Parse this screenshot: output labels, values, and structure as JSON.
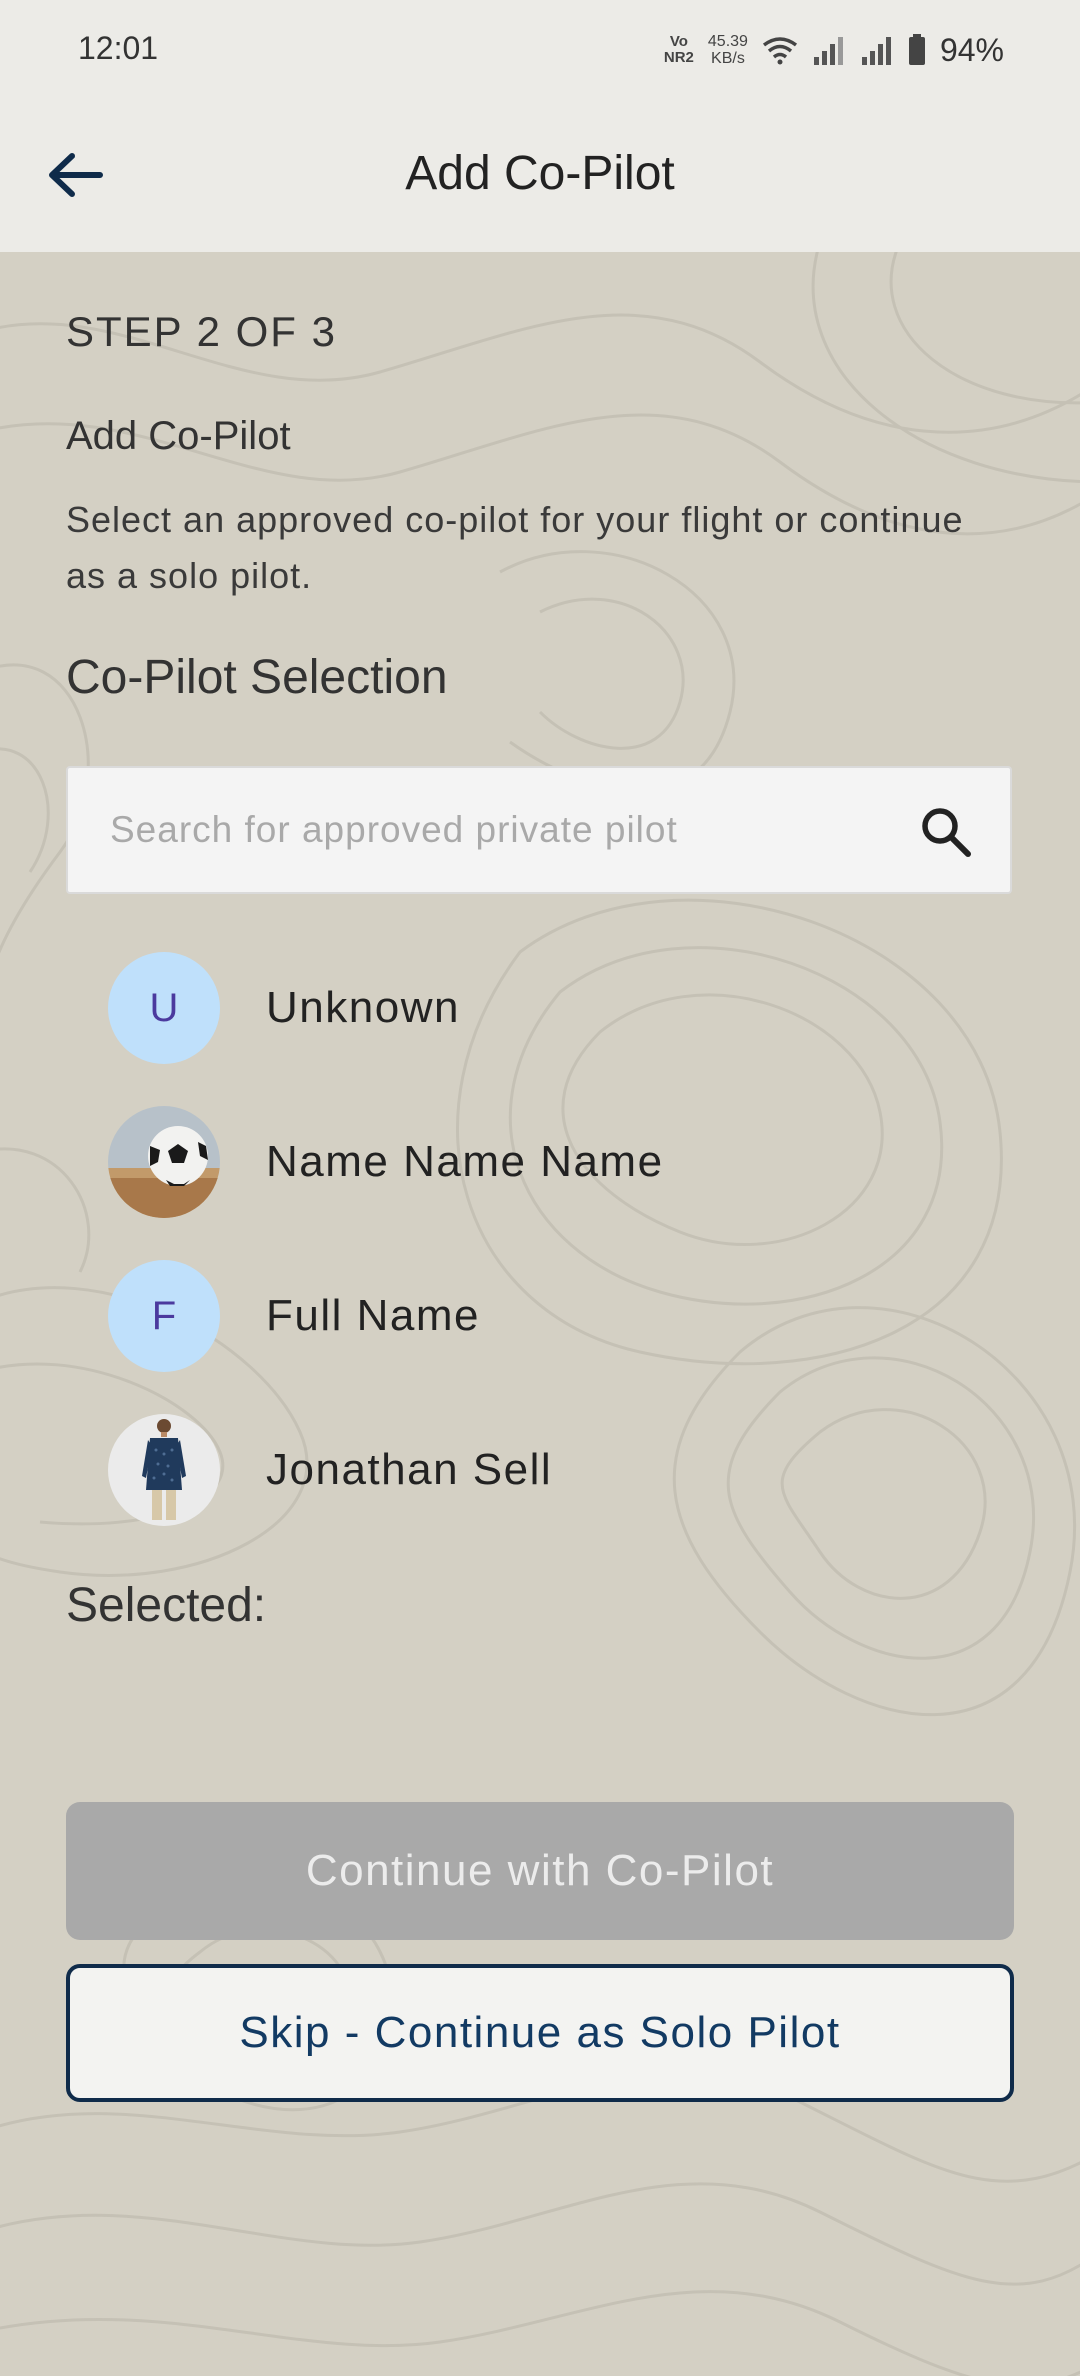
{
  "status_bar": {
    "time": "12:01",
    "net_type_top": "Vo",
    "net_type_bottom": "NR2",
    "net_speed_value": "45.39",
    "net_speed_unit": "KB/s",
    "battery": "94%"
  },
  "app_bar": {
    "title": "Add Co-Pilot",
    "back_icon": "arrow-left-icon"
  },
  "step": {
    "label": "STEP 2 OF 3",
    "heading": "Add Co-Pilot",
    "description": "Select an approved co-pilot for your flight or continue as a solo pilot."
  },
  "selection": {
    "heading": "Co-Pilot Selection",
    "search_placeholder": "Search for approved private pilot",
    "search_value": "",
    "search_icon": "search-icon"
  },
  "pilots": [
    {
      "name": "Unknown",
      "avatar_type": "letter",
      "initial": "U"
    },
    {
      "name": "Name Name Name",
      "avatar_type": "photo",
      "photo": "soccer-ball-photo"
    },
    {
      "name": "Full Name",
      "avatar_type": "letter",
      "initial": "F"
    },
    {
      "name": "Jonathan Sell",
      "avatar_type": "photo",
      "photo": "man-in-kurta-photo"
    }
  ],
  "selected": {
    "label": "Selected:"
  },
  "actions": {
    "continue_label": "Continue with Co-Pilot",
    "skip_label": "Skip - Continue as Solo Pilot"
  },
  "colors": {
    "background": "#d4d0c4",
    "header": "#ecebe7",
    "avatar_bg": "#bfe0fb",
    "avatar_letter": "#4b3a9e",
    "primary_navy": "#0f2b4a",
    "disabled_button": "#a9a9a9"
  }
}
